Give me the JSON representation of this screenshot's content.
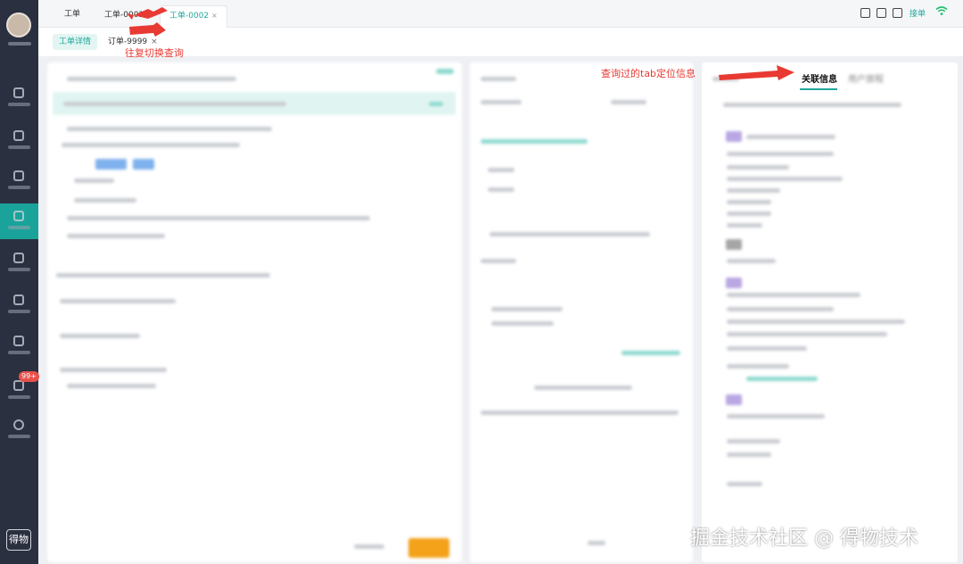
{
  "nav": {
    "items": [
      "home",
      "call",
      "monitor",
      "workorder",
      "alert",
      "knowledge",
      "report",
      "message",
      "settings"
    ],
    "active_index": 3,
    "badge": "99+",
    "logo": "得物"
  },
  "top_tabs": [
    {
      "label": "工单",
      "closable": false
    },
    {
      "label": "工单-0001",
      "closable": true
    },
    {
      "label": "工单-0002",
      "closable": true,
      "active": true
    }
  ],
  "close_glyph": "×",
  "top_right": {
    "jiedan": "接单",
    "icons": [
      "grid-icon",
      "store-icon",
      "edit-icon"
    ]
  },
  "sub_tabs": [
    {
      "label": "工单详情",
      "active": true
    },
    {
      "label": "订单-9999",
      "closable": true
    }
  ],
  "annotations": {
    "switch": "往复切换查询",
    "locate": "查询过的tab定位信息"
  },
  "right_panel": {
    "tabs": [
      "关联信息",
      "用户旅程"
    ],
    "active": "关联信息"
  },
  "watermark": "掘金技术社区 @ 得物技术",
  "colors": {
    "accent": "#21a89b",
    "annotation": "#e83a32",
    "nav": "#2b3040"
  }
}
